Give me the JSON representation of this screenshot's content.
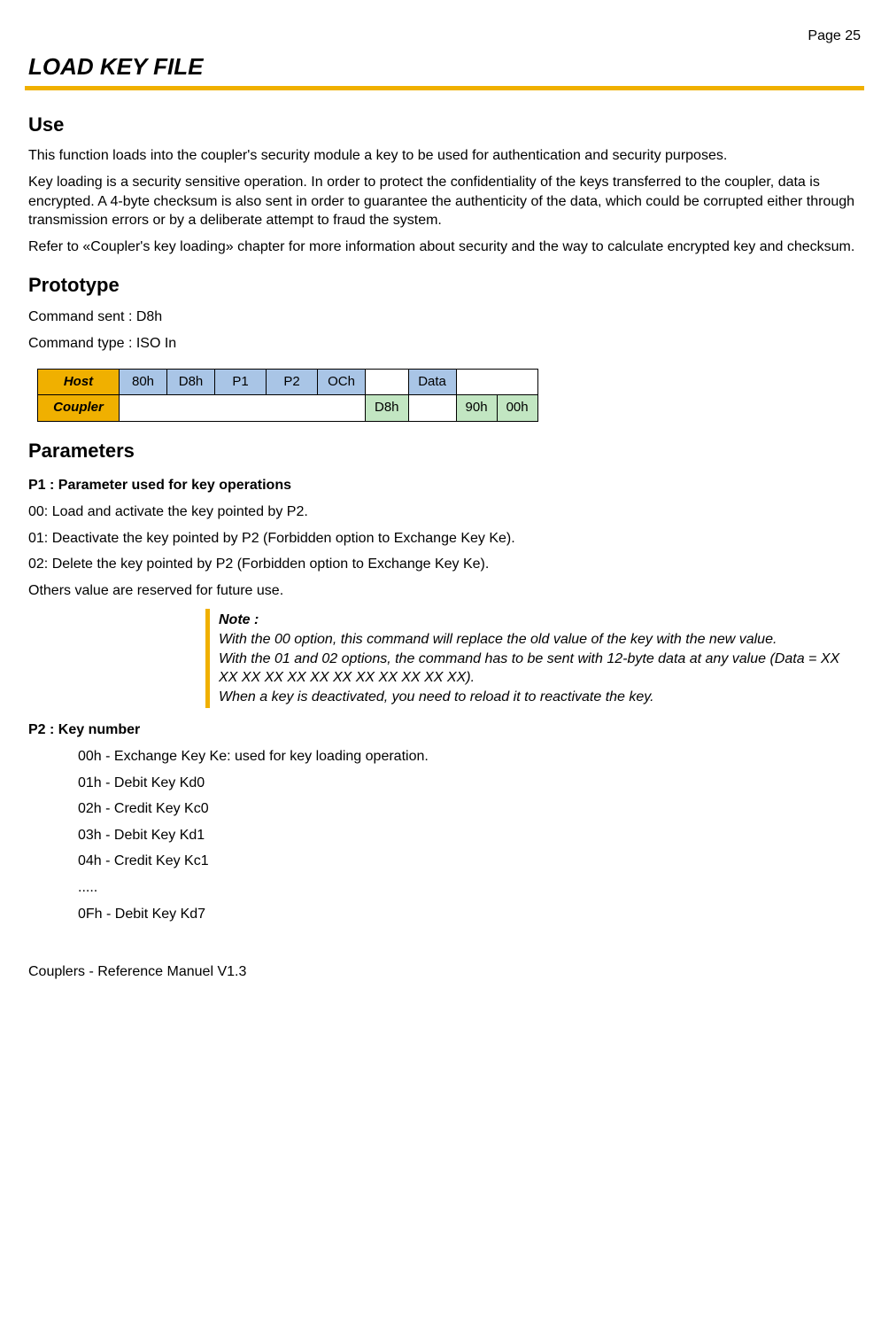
{
  "page_label": "Page 25",
  "title": "LOAD KEY FILE",
  "use": {
    "heading": "Use",
    "p1": "This function loads into the coupler's security module a key to be used for authentication and security purposes.",
    "p2": "Key loading is a security sensitive operation. In order to protect the confidentiality of the keys transferred to the coupler, data is encrypted. A 4-byte checksum is also sent in order to guarantee the authenticity of the data, which could be corrupted either through transmission errors or by a deliberate attempt to fraud the system.",
    "p3": "Refer to «Coupler's key loading» chapter for more information about security and the way to calculate encrypted key and checksum."
  },
  "prototype": {
    "heading": "Prototype",
    "cmd_sent": "Command sent : D8h",
    "cmd_type": "Command type : ISO In",
    "row_host_label": "Host",
    "row_coupler_label": "Coupler",
    "host_cells": [
      "80h",
      "D8h",
      "P1",
      "P2",
      "OCh",
      "",
      "Data",
      ""
    ],
    "coupler_cells": [
      "",
      "",
      "",
      "",
      "",
      "D8h",
      "",
      "90h",
      "00h"
    ]
  },
  "parameters": {
    "heading": "Parameters",
    "p1_heading": "P1 : Parameter used for key operations",
    "p1_00": "00: Load and activate the key pointed by P2.",
    "p1_01": "01: Deactivate the key pointed by P2 (Forbidden option to Exchange Key Ke).",
    "p1_02": "02: Delete the key pointed by P2 (Forbidden option to Exchange Key Ke).",
    "p1_others": "Others value are reserved for future use.",
    "note_label": "Note :",
    "note_l1": "With the 00 option, this command will replace the old value of the key with the new value.",
    "note_l2": "With the 01 and 02 options, the command has to be sent with 12-byte data at any value (Data = XX XX XX XX XX XX XX XX XX XX XX XX).",
    "note_l3": "When a key is deactivated, you need to reload it to reactivate the key.",
    "p2_heading": "P2 : Key number",
    "keys": [
      "00h - Exchange Key Ke: used for key loading operation.",
      "01h - Debit Key Kd0",
      "02h - Credit Key Kc0",
      "03h - Debit Key Kd1",
      "04h - Credit Key Kc1"
    ],
    "dots": ".....",
    "key_last": "0Fh - Debit Key Kd7"
  },
  "footer": "Couplers - Reference Manuel V1.3"
}
